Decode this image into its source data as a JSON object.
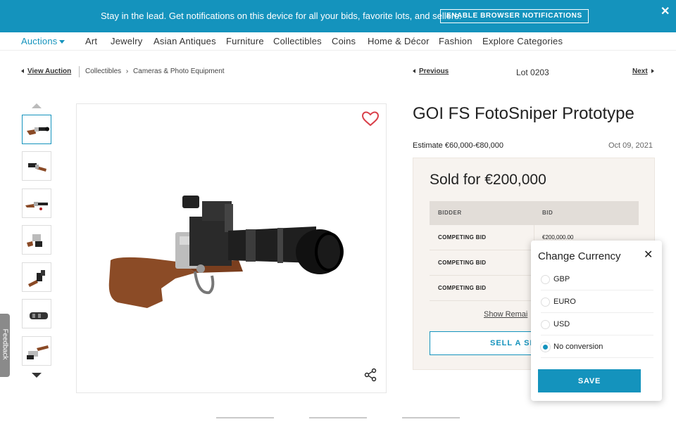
{
  "banner": {
    "message": "Stay in the lead. Get notifications on this device for all your bids, favorite lots, and sellers.",
    "enable_button": "ENABLE BROWSER NOTIFICATIONS",
    "close": "✕"
  },
  "nav": {
    "auctions": "Auctions",
    "items": [
      "Art",
      "Jewelry",
      "Asian Antiques",
      "Furniture",
      "Collectibles",
      "Coins",
      "Home & Décor",
      "Fashion",
      "Explore Categories"
    ]
  },
  "breadcrumb": {
    "view_auction": "View Auction",
    "category": "Collectibles",
    "subcategory": "Cameras & Photo Equipment"
  },
  "lot_nav": {
    "previous": "Previous",
    "lot_number": "Lot 0203",
    "next": "Next"
  },
  "lot": {
    "title": "GOI FS FotoSniper Prototype",
    "estimate": "Estimate €60,000-€80,000",
    "date": "Oct 09, 2021",
    "sold": "Sold for €200,000"
  },
  "bids": {
    "headers": [
      "BIDDER",
      "BID"
    ],
    "rows": [
      {
        "bidder": "COMPETING BID",
        "bid": "€200,000.00"
      },
      {
        "bidder": "COMPETING BID",
        "bid": ""
      },
      {
        "bidder": "COMPETING BID",
        "bid": ""
      }
    ],
    "show_remaining": "Show Remai",
    "sell_button": "SELL A SI"
  },
  "currency_popup": {
    "title": "Change Currency",
    "close": "✕",
    "options": [
      {
        "label": "GBP",
        "selected": false
      },
      {
        "label": "EURO",
        "selected": false
      },
      {
        "label": "USD",
        "selected": false
      },
      {
        "label": "No conversion",
        "selected": true
      }
    ],
    "save": "SAVE"
  },
  "feedback": "Feedback",
  "colors": {
    "accent": "#1493bd",
    "heart": "#d9404a",
    "panel": "#f7f3ef"
  }
}
